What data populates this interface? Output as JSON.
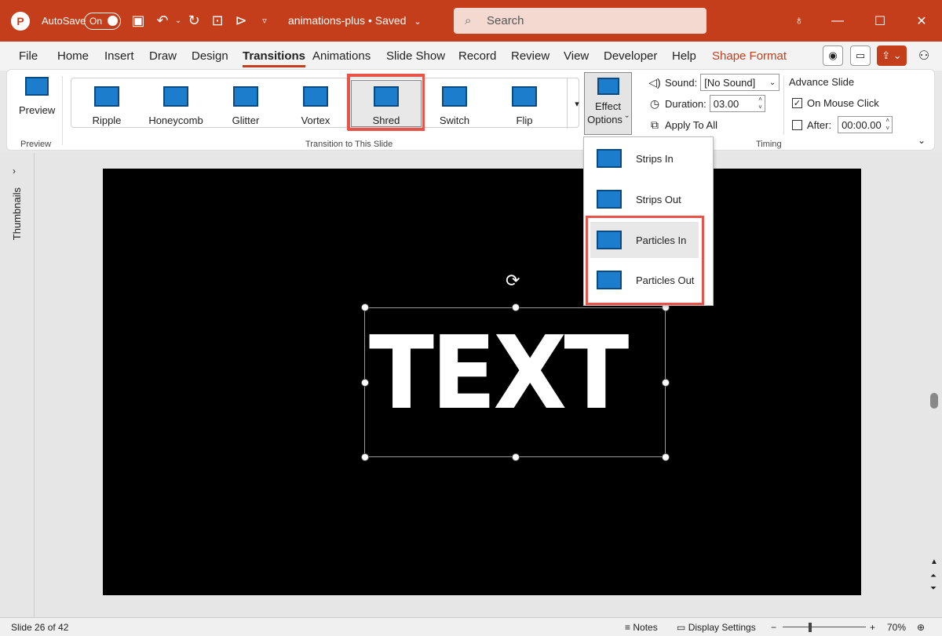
{
  "titlebar": {
    "logo": "P",
    "autosave_label": "AutoSave",
    "autosave_state": "On",
    "doc_title": "animations-plus • Saved",
    "search_placeholder": "Search",
    "icons": [
      "save-icon",
      "undo-icon",
      "redo-icon",
      "present-icon",
      "quick-access-more-icon"
    ]
  },
  "menu": {
    "tabs": [
      "File",
      "Home",
      "Insert",
      "Draw",
      "Design",
      "Transitions",
      "Animations",
      "Slide Show",
      "Record",
      "Review",
      "View",
      "Developer",
      "Help",
      "Shape Format"
    ],
    "active_tab": "Transitions"
  },
  "ribbon": {
    "preview_label": "Preview",
    "preview_group": "Preview",
    "transitions": [
      "Ripple",
      "Honeycomb",
      "Glitter",
      "Vortex",
      "Shred",
      "Switch",
      "Flip"
    ],
    "selected_transition": "Shred",
    "transition_group": "Transition to This Slide",
    "effect_options_line1": "Effect",
    "effect_options_line2": "Options ˇ",
    "sound_label": "Sound:",
    "sound_value": "[No Sound]",
    "duration_label": "Duration:",
    "duration_value": "03.00",
    "apply_all": "Apply To All",
    "advance_label": "Advance Slide",
    "on_mouse_click": "On Mouse Click",
    "on_mouse_click_checked": true,
    "after_label": "After:",
    "after_value": "00:00.00",
    "after_checked": false,
    "timing_group": "Timing"
  },
  "dropdown": {
    "items": [
      "Strips In",
      "Strips Out",
      "Particles In",
      "Particles Out"
    ],
    "hovered": "Particles In"
  },
  "slide": {
    "text": "TEXT",
    "thumbnails_label": "Thumbnails"
  },
  "status": {
    "slide_counter": "Slide 26 of 42",
    "notes": "Notes",
    "display_settings": "Display Settings",
    "zoom_minus": "−",
    "zoom_plus": "+",
    "zoom": "70%"
  },
  "colors": {
    "brand": "#c43e1c",
    "highlight_box": "#e8534a",
    "icon_blue": "#1c7dcc"
  }
}
